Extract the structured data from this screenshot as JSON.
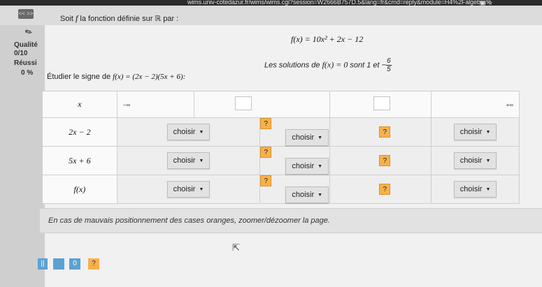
{
  "browser": {
    "url": "wims.univ-cotedazur.fr/wims/wims.cgi?session=W2666B757D.5&lang=fr&cmd=reply&module=H4%2Falgebra%",
    "icons": [
      "reader-icon",
      "star-icon"
    ]
  },
  "nav": {
    "button_label": "<< >>"
  },
  "intro": {
    "text_prefix": "Soit ",
    "fname": "f",
    "text_suffix": " la fonction définie sur ℝ par :"
  },
  "equation": {
    "text": "f(x) = 10x² + 2x − 12"
  },
  "solutions": {
    "prefix": "Les solutions de ",
    "eq": "f(x) = 0",
    "middle": " sont 1 et ",
    "sign": "−",
    "num": "6",
    "den": "5"
  },
  "sidebar": {
    "quality_label": "Qualité",
    "quality_value": "0/10",
    "success_label": "Réussi",
    "success_value": "0 %"
  },
  "study": {
    "prefix": "Étudier le signe de ",
    "expr": "f(x) = (2x − 2)(5x + 6):"
  },
  "table": {
    "header": {
      "x": "x",
      "minus_inf": "−∞",
      "plus_inf": "+∞"
    },
    "rows": [
      {
        "label": "2x − 2"
      },
      {
        "label": "5x + 6"
      },
      {
        "label": "f(x)"
      }
    ],
    "choose_label": "choisir",
    "unknown_label": "?"
  },
  "note": "En cas de mauvais positionnement des cases oranges, zoomer/dézoomer la page.",
  "controls": {
    "pause": "||",
    "zero": "0",
    "help": "?"
  }
}
